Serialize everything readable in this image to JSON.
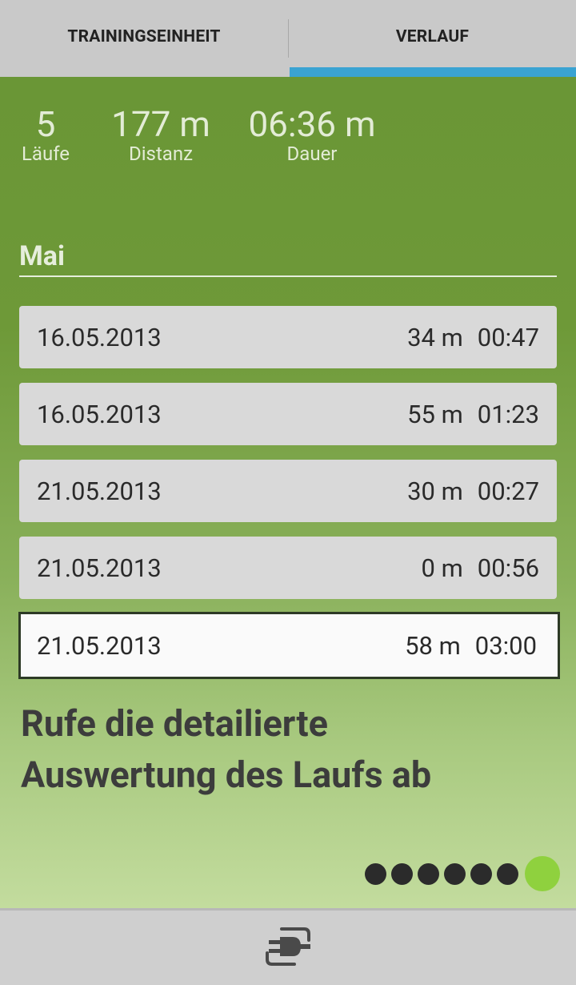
{
  "tabs": {
    "training_label": "TRAININGSEINHEIT",
    "history_label": "VERLAUF",
    "active": "history"
  },
  "summary": {
    "runs_value": "5",
    "runs_label": "Läufe",
    "distance_value": "177 m",
    "distance_label": "Distanz",
    "duration_value": "06:36 m",
    "duration_label": "Dauer"
  },
  "month_header": "Mai",
  "runs": [
    {
      "date": "16.05.2013",
      "distance": "34 m",
      "time": "00:47"
    },
    {
      "date": "16.05.2013",
      "distance": "55 m",
      "time": "01:23"
    },
    {
      "date": "21.05.2013",
      "distance": "30 m",
      "time": "00:27"
    },
    {
      "date": "21.05.2013",
      "distance": "0 m",
      "time": "00:56"
    },
    {
      "date": "21.05.2013",
      "distance": "58 m",
      "time": "03:00"
    }
  ],
  "selected_run_index": 4,
  "hint_line1": "Rufe die detailierte",
  "hint_line2": "Auswertung des Laufs ab",
  "pager": {
    "total": 7,
    "current": 7
  },
  "bottom_bar": {
    "icon": "plug-connect-icon"
  },
  "colors": {
    "tab_indicator": "#3aa3d2",
    "background_top": "#6a9636",
    "background_bottom": "#c3dc9e",
    "active_dot": "#8fd13e"
  }
}
